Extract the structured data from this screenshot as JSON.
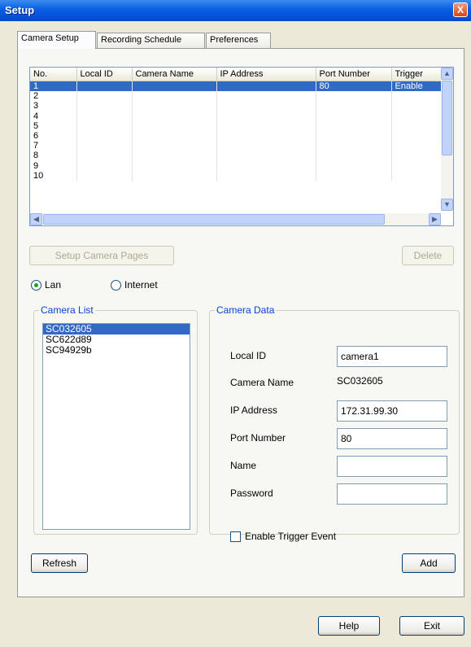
{
  "window": {
    "title": "Setup",
    "close_glyph": "X"
  },
  "tabs": [
    "Camera Setup",
    "Recording Schedule",
    "Preferences"
  ],
  "grid": {
    "columns": [
      "No.",
      "Local ID",
      "Camera Name",
      "IP Address",
      "Port Number",
      "Trigger"
    ],
    "rows": [
      [
        "1",
        "",
        "",
        "",
        "80",
        "Enable"
      ],
      [
        "2",
        "",
        "",
        "",
        "",
        ""
      ],
      [
        "3",
        "",
        "",
        "",
        "",
        ""
      ],
      [
        "4",
        "",
        "",
        "",
        "",
        ""
      ],
      [
        "5",
        "",
        "",
        "",
        "",
        ""
      ],
      [
        "6",
        "",
        "",
        "",
        "",
        ""
      ],
      [
        "7",
        "",
        "",
        "",
        "",
        ""
      ],
      [
        "8",
        "",
        "",
        "",
        "",
        ""
      ],
      [
        "9",
        "",
        "",
        "",
        "",
        ""
      ],
      [
        "10",
        "",
        "",
        "",
        "",
        ""
      ]
    ]
  },
  "buttons": {
    "setup_pages": "Setup Camera Pages",
    "delete": "Delete",
    "refresh": "Refresh",
    "add": "Add",
    "help": "Help",
    "exit": "Exit"
  },
  "connection": {
    "lan": "Lan",
    "internet": "Internet",
    "selected": "Lan"
  },
  "camera_list": {
    "legend": "Camera List",
    "items": [
      "SC032605",
      "SC622d89",
      "SC94929b"
    ],
    "selected_index": 0
  },
  "camera_data": {
    "legend": "Camera Data",
    "local_id_label": "Local ID",
    "local_id_value": "camera1",
    "camera_name_label": "Camera Name",
    "camera_name_value": "SC032605",
    "ip_label": "IP Address",
    "ip_value": "172.31.99.30",
    "port_label": "Port Number",
    "port_value": "80",
    "name_label": "Name",
    "name_value": "",
    "password_label": "Password",
    "password_value": "",
    "trigger_label": "Enable Trigger Event",
    "trigger_checked": false
  },
  "icons": {
    "scroll_up": "▲",
    "scroll_down": "▼",
    "scroll_left": "◀",
    "scroll_right": "▶"
  },
  "colors": {
    "title_bar": "#0a5ee0",
    "selection": "#316ac5",
    "legend": "#0046d5"
  }
}
